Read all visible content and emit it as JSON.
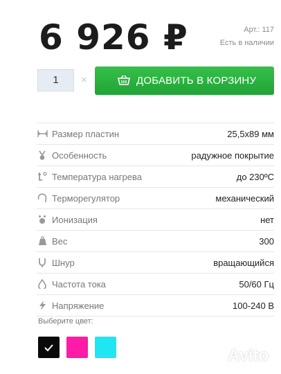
{
  "product": {
    "price": "6 926 ₽",
    "article": "Арт.: 117",
    "stock": "Есть в наличии"
  },
  "cart": {
    "quantity": "1",
    "times_sign": "×",
    "add_label": "ДОБАВИТЬ В КОРЗИНУ",
    "accent_color": "#2db544"
  },
  "specs": [
    {
      "icon": "plates-size-icon",
      "name": "Размер пластин",
      "value": "25,5х89 мм"
    },
    {
      "icon": "feature-icon",
      "name": "Особенность",
      "value": "радужное покрытие"
    },
    {
      "icon": "temperature-icon",
      "name": "Температура нагрева",
      "value": "до 230ºС"
    },
    {
      "icon": "thermostat-icon",
      "name": "Терморегулятор",
      "value": "механический"
    },
    {
      "icon": "ionization-icon",
      "name": "Ионизация",
      "value": "нет"
    },
    {
      "icon": "weight-icon",
      "name": "Вес",
      "value": "300"
    },
    {
      "icon": "cord-icon",
      "name": "Шнур",
      "value": "вращающийся"
    },
    {
      "icon": "frequency-icon",
      "name": "Частота тока",
      "value": "50/60 Гц"
    },
    {
      "icon": "voltage-icon",
      "name": "Напряжение",
      "value": "100-240 В"
    }
  ],
  "colors": {
    "title": "Выберите цвет:",
    "options": [
      {
        "name": "black",
        "hex": "#0a0a0a",
        "selected": true
      },
      {
        "name": "pink",
        "hex": "#ff1aa8",
        "selected": false
      },
      {
        "name": "cyan",
        "hex": "#1ee6f2",
        "selected": false
      }
    ]
  },
  "watermark": {
    "text": "Avito"
  }
}
